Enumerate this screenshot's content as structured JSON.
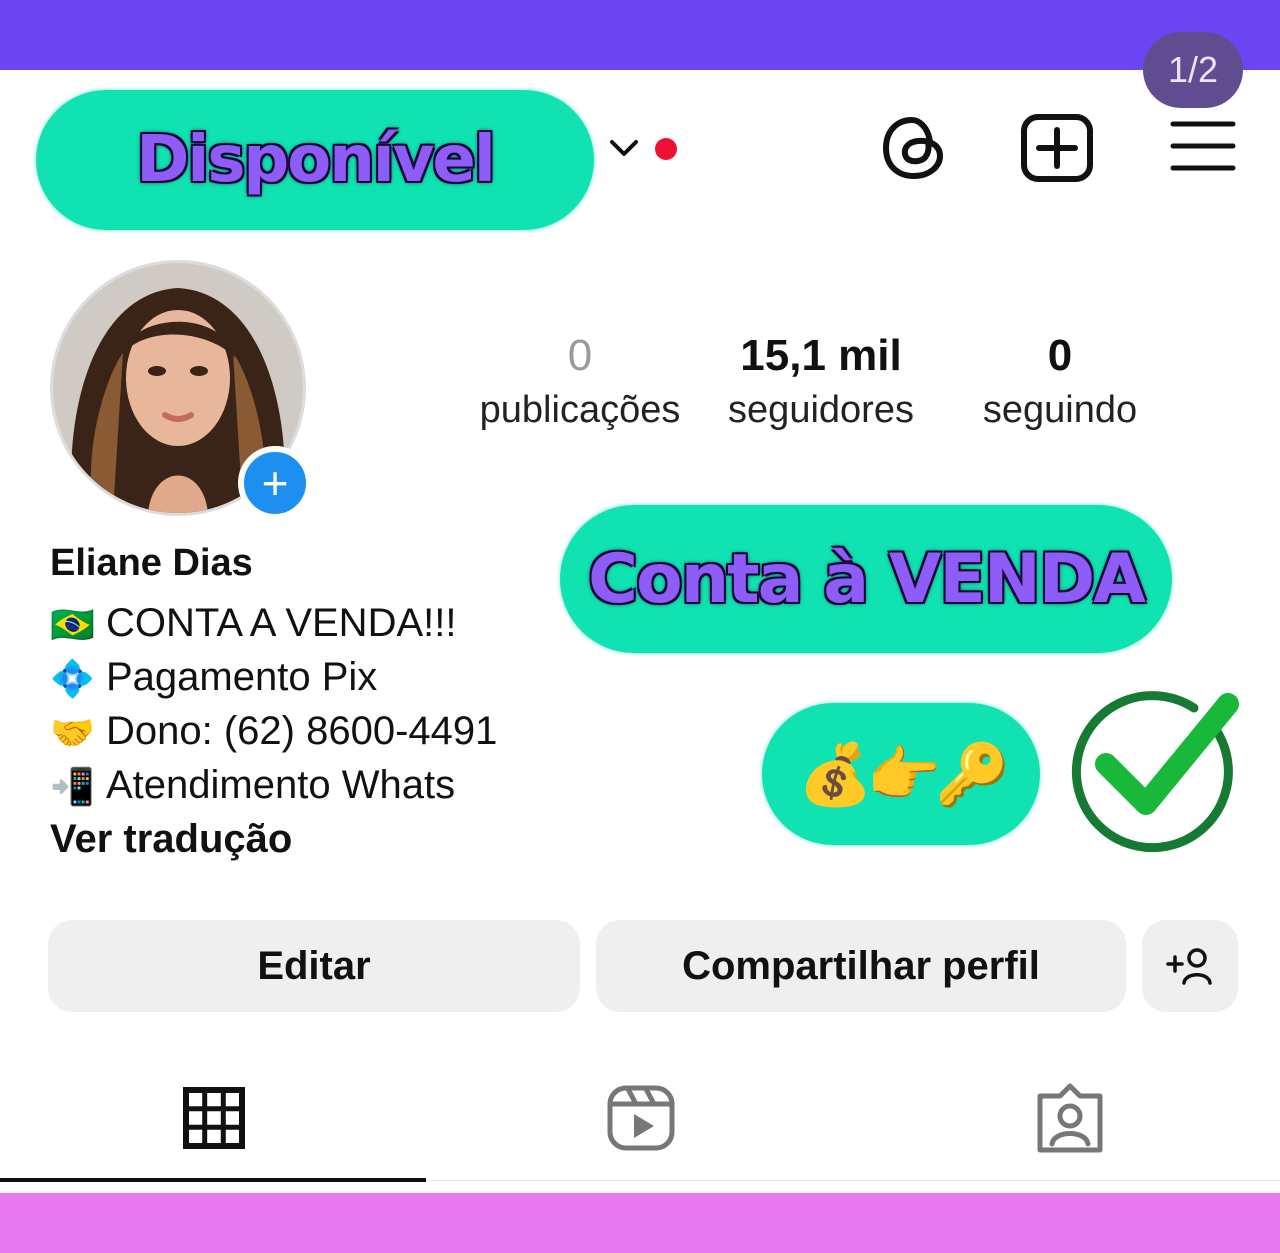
{
  "overlay": {
    "page_counter": "1/2",
    "status_label": "Disponível",
    "sale_label": "Conta à VENDA",
    "emoji_row": "💰👉🔑",
    "colors": {
      "pill": "#10e3b1",
      "pill_text": "#8e5cf6",
      "top_band": "#6c45f2",
      "bottom_band": "#e77af0",
      "check": "#18b83a"
    }
  },
  "header": {
    "notification_color": "#ee1133",
    "icons": [
      "chevron-down-icon",
      "threads-icon",
      "add-post-icon",
      "menu-icon"
    ]
  },
  "profile": {
    "name": "Eliane Dias",
    "stats": [
      {
        "value": "0",
        "label": "publicações"
      },
      {
        "value": "15,1 mil",
        "label": "seguidores"
      },
      {
        "value": "0",
        "label": "seguindo"
      }
    ],
    "bio": [
      {
        "emoji": "🇧🇷",
        "text": "CONTA A VENDA!!!"
      },
      {
        "emoji": "💠",
        "text": "Pagamento Pix"
      },
      {
        "emoji": "🤝",
        "text": "Dono: (62) 8600-4491"
      },
      {
        "emoji": "📲",
        "text": "Atendimento Whats"
      }
    ],
    "translate_link": "Ver tradução"
  },
  "actions": {
    "edit": "Editar",
    "share": "Compartilhar perfil"
  },
  "tabs": [
    {
      "icon": "grid-icon",
      "active": true
    },
    {
      "icon": "reels-icon",
      "active": false
    },
    {
      "icon": "tagged-icon",
      "active": false
    }
  ]
}
